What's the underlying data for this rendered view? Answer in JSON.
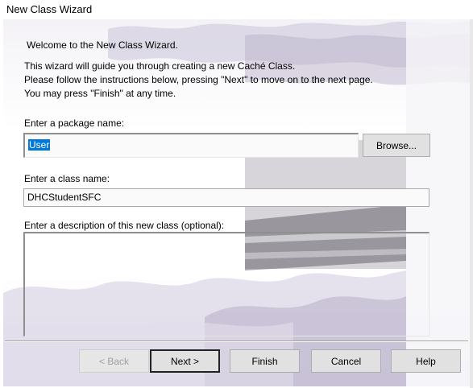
{
  "window": {
    "title": "New Class Wizard"
  },
  "intro": {
    "welcome": "Welcome to the New Class Wizard.",
    "line1": "This wizard will guide you through creating a new  Caché  Class.",
    "line2": "Please follow the instructions below, pressing \"Next\" to move on to the next page.",
    "line3": "You may press \"Finish\" at any time."
  },
  "package": {
    "label": "Enter a package name:",
    "value": "User",
    "browse_label": "Browse..."
  },
  "classname": {
    "label": "Enter a class name:",
    "value": "DHCStudentSFC"
  },
  "description": {
    "label": "Enter a description of this new class (optional):",
    "value": ""
  },
  "buttons": {
    "back": "< Back",
    "next": "Next >",
    "finish": "Finish",
    "cancel": "Cancel",
    "help": "Help"
  },
  "colors": {
    "selection": "#0078d7",
    "accent_purple": "#b7aec8"
  }
}
